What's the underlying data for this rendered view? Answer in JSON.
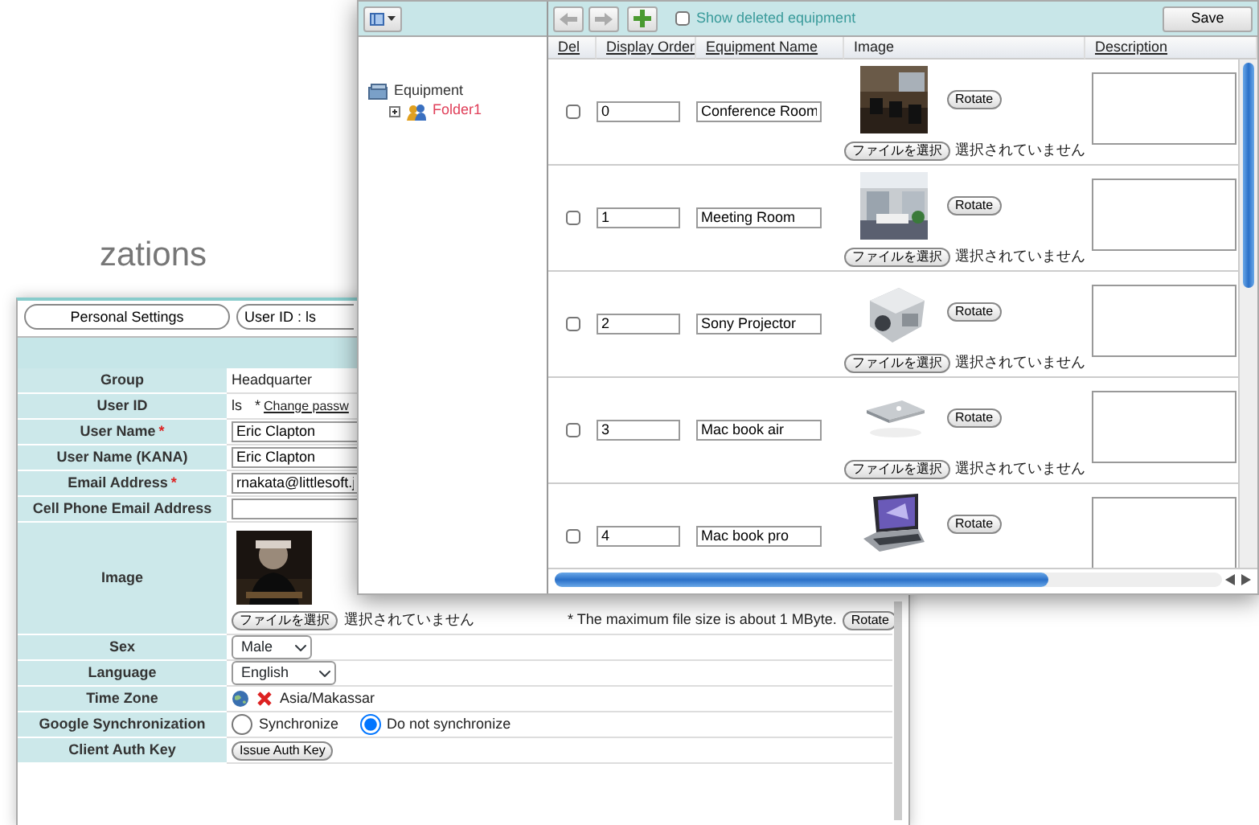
{
  "background_text": "zations",
  "settings_window": {
    "header_buttons": [
      "Personal Settings",
      "User ID : ls"
    ],
    "rows": [
      {
        "label": "Group",
        "kind": "text",
        "value": "Headquarter"
      },
      {
        "label": "User ID",
        "kind": "userid",
        "value": "ls",
        "note": "*",
        "link": "Change passw"
      },
      {
        "label": "User Name",
        "required_mark": "*",
        "kind": "input",
        "value": "Eric Clapton"
      },
      {
        "label": "User Name (KANA)",
        "kind": "input",
        "value": "Eric Clapton"
      },
      {
        "label": "Email Address",
        "required_mark": "*",
        "kind": "input",
        "value": "rnakata@littlesoft.j"
      },
      {
        "label": "Cell Phone Email Address",
        "kind": "input"
      },
      {
        "label": "Image",
        "file_button": "ファイルを選択",
        "file_status": "選択されていません",
        "note": "* The maximum file size is about 1 MByte.",
        "rotate": "Rotate"
      },
      {
        "label": "Sex",
        "kind": "select",
        "value": "Male"
      },
      {
        "label": "Language",
        "kind": "select",
        "value": "English"
      },
      {
        "label": "Time Zone",
        "kind": "timezone",
        "value": "Asia/Makassar"
      },
      {
        "label": "Google Synchronization",
        "kind": "radio",
        "options": [
          {
            "label": "Synchronize",
            "selected": false
          },
          {
            "label": "Do not synchronize",
            "selected": true
          }
        ]
      },
      {
        "label": "Client Auth Key",
        "kind": "button",
        "button": "Issue Auth Key"
      }
    ]
  },
  "equipment_window": {
    "tree": [
      {
        "label": "Equipment",
        "selected": false,
        "children": [
          {
            "label": "Folder1",
            "selected": true,
            "expanded": false
          }
        ]
      }
    ],
    "show_deleted": {
      "label": "Show deleted equipment",
      "checked": false
    },
    "save_button": "Save",
    "columns": [
      {
        "label": "Del",
        "sortable": true
      },
      {
        "label": "Display Order",
        "sortable": true
      },
      {
        "label": "Equipment Name",
        "sortable": true
      },
      {
        "label": "Image",
        "sortable": false
      },
      {
        "label": "Description",
        "sortable": true
      }
    ],
    "rows": [
      {
        "del": false,
        "order": "0",
        "name": "Conference Room",
        "rotate": "Rotate",
        "file_button": "ファイルを選択",
        "file_status": "選択されていません"
      },
      {
        "del": false,
        "order": "1",
        "name": "Meeting Room",
        "rotate": "Rotate",
        "file_button": "ファイルを選択",
        "file_status": "選択されていません"
      },
      {
        "del": false,
        "order": "2",
        "name": "Sony Projector",
        "rotate": "Rotate",
        "file_button": "ファイルを選択",
        "file_status": "選択されていません"
      },
      {
        "del": false,
        "order": "3",
        "name": "Mac book air",
        "rotate": "Rotate",
        "file_button": "ファイルを選択",
        "file_status": "選択されていません"
      },
      {
        "del": false,
        "order": "4",
        "name": "Mac book pro",
        "rotate": "Rotate"
      }
    ]
  }
}
